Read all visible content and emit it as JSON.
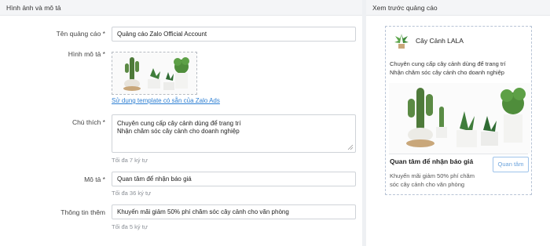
{
  "left_panel": {
    "title": "Hình ảnh và mô tả",
    "ad_name": {
      "label": "Tên quảng cáo *",
      "value": "Quảng cáo Zalo Official Account"
    },
    "image": {
      "label": "Hình mô tả *",
      "template_link": "Sử dụng template có sẵn của Zalo Ads"
    },
    "note": {
      "label": "Chú thích *",
      "line1": "Chuyên cung cấp cây cảnh dùng để trang trí",
      "line2": "Nhận chăm sóc cây cảnh cho doanh nghiệp",
      "hint": "Tối đa 7 ký tự"
    },
    "description": {
      "label": "Mô tả *",
      "value": "Quan tâm để nhận báo giá",
      "hint": "Tối đa 36 ký tự"
    },
    "extra_info": {
      "label": "Thông tin thêm",
      "value": "Khuyến mãi giảm 50% phí chăm sóc cây cảnh cho văn phòng",
      "hint": "Tối đa 5 ký tự"
    }
  },
  "preview_panel": {
    "title": "Xem trước quảng cáo",
    "card": {
      "account_name": "Cây Cảnh LALA",
      "desc_line1": "Chuyên cung cấp cây cảnh dùng để trang trí",
      "desc_line2": "Nhận chăm sóc cây cảnh cho doanh nghiệp",
      "headline": "Quan tâm để nhận báo giá",
      "sub_text": "Khuyến mãi giảm 50% phí chăm sóc cây cảnh cho văn phòng",
      "cta_label": "Quan tâm"
    }
  },
  "icons": [
    "plant-thumbnail-icon",
    "resize-grip-icon"
  ],
  "colors": {
    "link": "#2d7fd3",
    "cta_border": "#9ec3ea",
    "header_bg": "#f4f5f7"
  }
}
